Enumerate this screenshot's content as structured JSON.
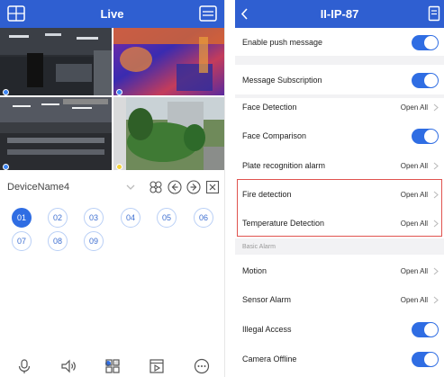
{
  "left_screen": {
    "title": "Live",
    "device_name": "DeviceName4",
    "channels": [
      {
        "label": "01",
        "active": true
      },
      {
        "label": "02",
        "active": false
      },
      {
        "label": "03",
        "active": false
      },
      {
        "label": "04",
        "active": false
      },
      {
        "label": "05",
        "active": false
      },
      {
        "label": "06",
        "active": false
      },
      {
        "label": "07",
        "active": false
      },
      {
        "label": "08",
        "active": false
      },
      {
        "label": "09",
        "active": false
      }
    ],
    "icons": {
      "top_left": "menu-grid-icon",
      "top_right": "list-icon",
      "device_controls": [
        "ptz-icon",
        "previous-icon",
        "next-icon",
        "close-all-icon"
      ],
      "bottom_toolbar": [
        "microphone-icon",
        "speaker-icon",
        "layout-icon",
        "playback-icon",
        "more-icon"
      ]
    },
    "accent_color": "#2f6de3"
  },
  "right_screen": {
    "title": "II-IP-87",
    "rows": [
      {
        "label": "Enable push message",
        "type": "toggle",
        "on": true
      },
      {
        "label": "Message Subscription",
        "type": "toggle",
        "on": true
      },
      {
        "label": "Face Detection",
        "type": "value",
        "value": "Open All"
      },
      {
        "label": "Face Comparison",
        "type": "toggle",
        "on": true
      },
      {
        "label": "Plate recognition alarm",
        "type": "value",
        "value": "Open All"
      },
      {
        "label": "Fire detection",
        "type": "value",
        "value": "Open All"
      },
      {
        "label": "Temperature Detection",
        "type": "value",
        "value": "Open All"
      },
      {
        "label": "Motion",
        "type": "value",
        "value": "Open All"
      },
      {
        "label": "Sensor Alarm",
        "type": "value",
        "value": "Open All"
      },
      {
        "label": "Illegal Access",
        "type": "toggle",
        "on": true
      },
      {
        "label": "Camera Offline",
        "type": "toggle",
        "on": true
      }
    ],
    "section_header": "Basic Alarm",
    "icons": {
      "back": "back-chevron-icon",
      "top_right": "document-icon"
    },
    "highlight_color": "#e0534f"
  }
}
